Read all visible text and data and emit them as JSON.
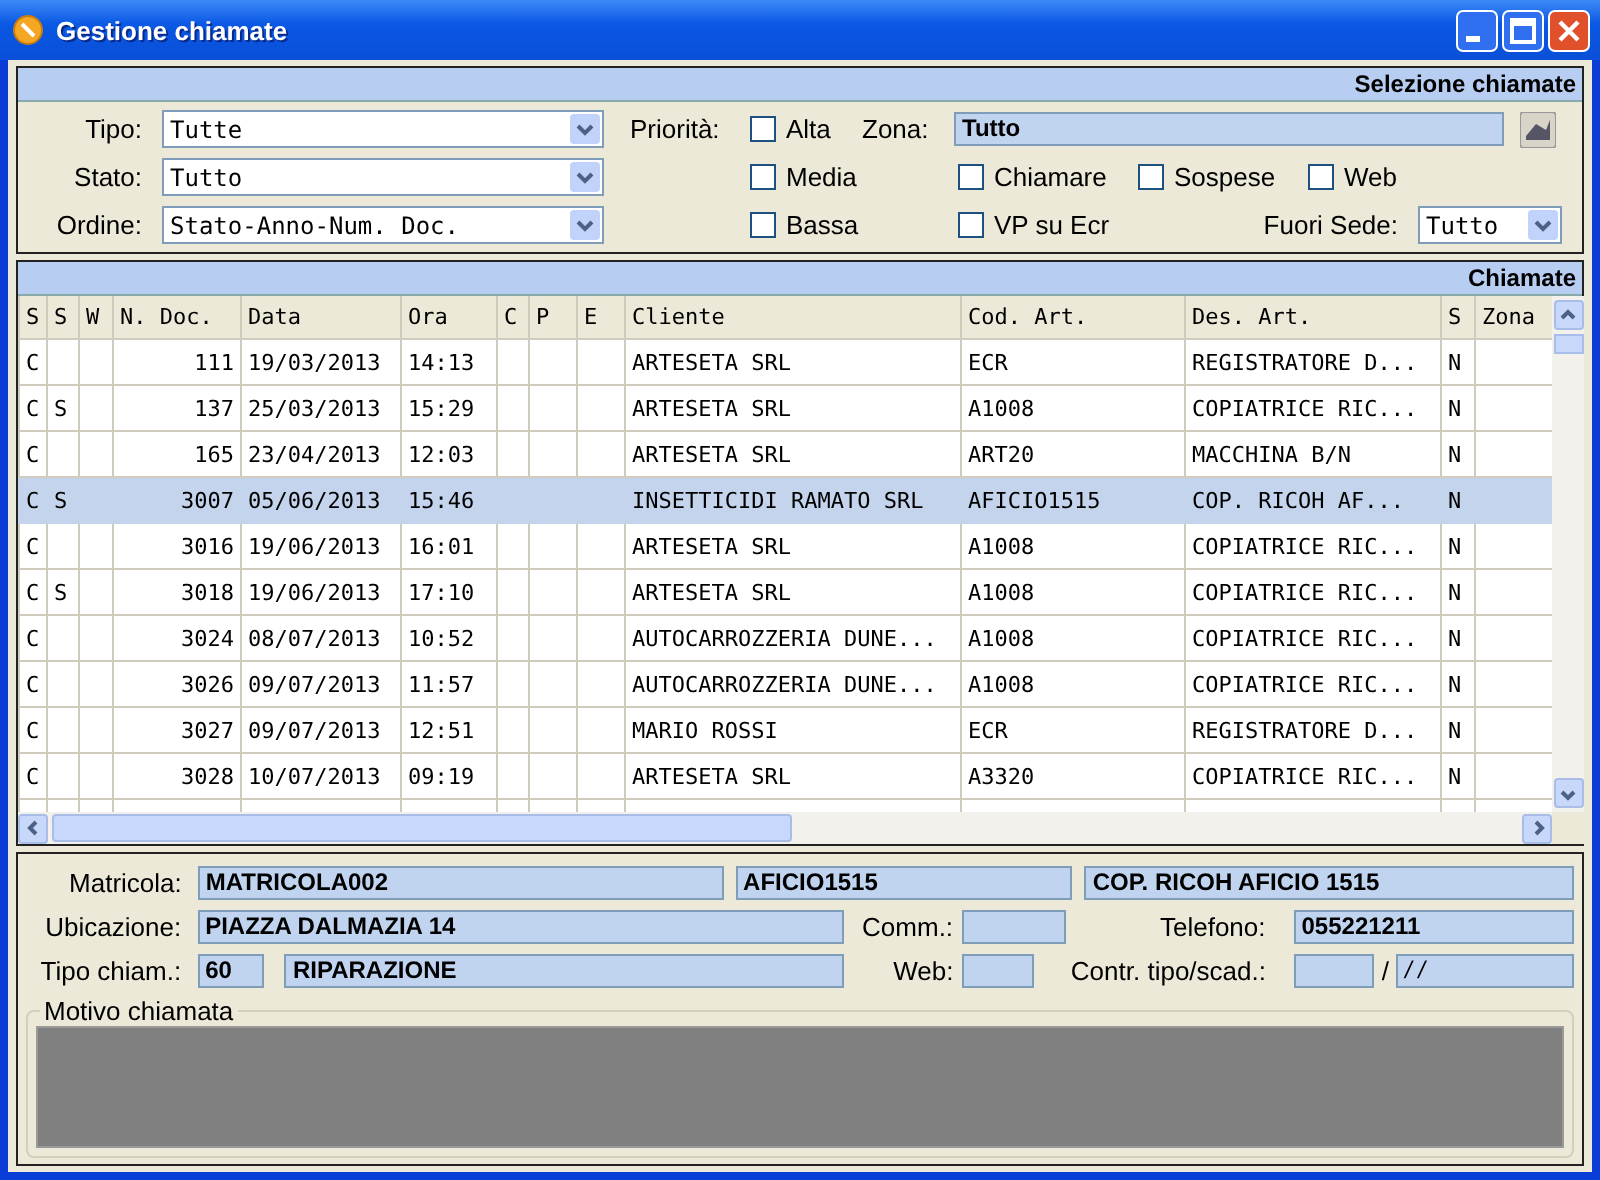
{
  "window": {
    "title": "Gestione chiamate"
  },
  "filters": {
    "header": "Selezione chiamate",
    "combos": [
      {
        "label": "Tipo:",
        "value": "Tutte"
      },
      {
        "label": "Stato:",
        "value": "Tutto"
      },
      {
        "label": "Ordine:",
        "value": "Stato-Anno-Num. Doc."
      }
    ],
    "priority": {
      "label": "Priorità:",
      "options": [
        {
          "label": "Alta",
          "checked": false
        },
        {
          "label": "Media",
          "checked": false
        },
        {
          "label": "Bassa",
          "checked": false
        }
      ]
    },
    "zona": {
      "label": "Zona:",
      "value": "Tutto"
    },
    "flags": [
      {
        "label": "Chiamare",
        "checked": false
      },
      {
        "label": "Sospese",
        "checked": false
      },
      {
        "label": "Web",
        "checked": false
      }
    ],
    "vp": {
      "label": "VP su Ecr",
      "checked": false
    },
    "fuori_sede": {
      "label": "Fuori Sede:",
      "value": "Tutto"
    }
  },
  "table": {
    "header": "Chiamate",
    "columns": [
      "S",
      "S",
      "W",
      "N. Doc.",
      "Data",
      "Ora",
      "C",
      "P",
      "E",
      "Cliente",
      "Cod. Art.",
      "Des. Art.",
      "S",
      "Zona"
    ],
    "rows": [
      {
        "selected": false,
        "cells": [
          "C",
          "",
          "",
          "111",
          "19/03/2013",
          "14:13",
          "",
          "",
          "",
          "ARTESETA SRL",
          "ECR",
          "REGISTRATORE D...",
          "N",
          ""
        ]
      },
      {
        "selected": false,
        "cells": [
          "C",
          "S",
          "",
          "137",
          "25/03/2013",
          "15:29",
          "",
          "",
          "",
          "ARTESETA SRL",
          "A1008",
          "COPIATRICE RIC...",
          "N",
          ""
        ]
      },
      {
        "selected": false,
        "cells": [
          "C",
          "",
          "",
          "165",
          "23/04/2013",
          "12:03",
          "",
          "",
          "",
          "ARTESETA SRL",
          "ART20",
          "MACCHINA B/N",
          "N",
          ""
        ]
      },
      {
        "selected": true,
        "cells": [
          "C",
          "S",
          "",
          "3007",
          "05/06/2013",
          "15:46",
          "",
          "",
          "",
          "INSETTICIDI RAMATO SRL",
          "AFICIO1515",
          "COP. RICOH  AF...",
          "N",
          ""
        ]
      },
      {
        "selected": false,
        "cells": [
          "C",
          "",
          "",
          "3016",
          "19/06/2013",
          "16:01",
          "",
          "",
          "",
          "ARTESETA SRL",
          "A1008",
          "COPIATRICE RIC...",
          "N",
          ""
        ]
      },
      {
        "selected": false,
        "cells": [
          "C",
          "S",
          "",
          "3018",
          "19/06/2013",
          "17:10",
          "",
          "",
          "",
          "ARTESETA SRL",
          "A1008",
          "COPIATRICE RIC...",
          "N",
          ""
        ]
      },
      {
        "selected": false,
        "cells": [
          "C",
          "",
          "",
          "3024",
          "08/07/2013",
          "10:52",
          "",
          "",
          "",
          "AUTOCARROZZERIA DUNE...",
          "A1008",
          "COPIATRICE RIC...",
          "N",
          ""
        ]
      },
      {
        "selected": false,
        "cells": [
          "C",
          "",
          "",
          "3026",
          "09/07/2013",
          "11:57",
          "",
          "",
          "",
          "AUTOCARROZZERIA DUNE...",
          "A1008",
          "COPIATRICE RIC...",
          "N",
          ""
        ]
      },
      {
        "selected": false,
        "cells": [
          "C",
          "",
          "",
          "3027",
          "09/07/2013",
          "12:51",
          "",
          "",
          "",
          "MARIO ROSSI",
          "ECR",
          "REGISTRATORE D...",
          "N",
          ""
        ]
      },
      {
        "selected": false,
        "cells": [
          "C",
          "",
          "",
          "3028",
          "10/07/2013",
          "09:19",
          "",
          "",
          "",
          "ARTESETA SRL",
          "A3320",
          "COPIATRICE RIC...",
          "N",
          ""
        ]
      }
    ]
  },
  "details": {
    "matricola": {
      "label": "Matricola:",
      "values": [
        "MATRICOLA002",
        "AFICIO1515",
        "COP. RICOH  AFICIO 1515"
      ]
    },
    "ubicazione": {
      "label": "Ubicazione:",
      "value": "PIAZZA DALMAZIA 14"
    },
    "comm": {
      "label": "Comm.:"
    },
    "telefono": {
      "label": "Telefono:",
      "value": "055221211"
    },
    "tipo": {
      "label": "Tipo chiam.:",
      "code": "60",
      "value": "RIPARAZIONE"
    },
    "web": {
      "label": "Web:"
    },
    "contratto": {
      "label": "Contr. tipo/scad.:",
      "separator": "/",
      "date": "/ /"
    },
    "motivo": {
      "label": "Motivo chiamata"
    }
  }
}
